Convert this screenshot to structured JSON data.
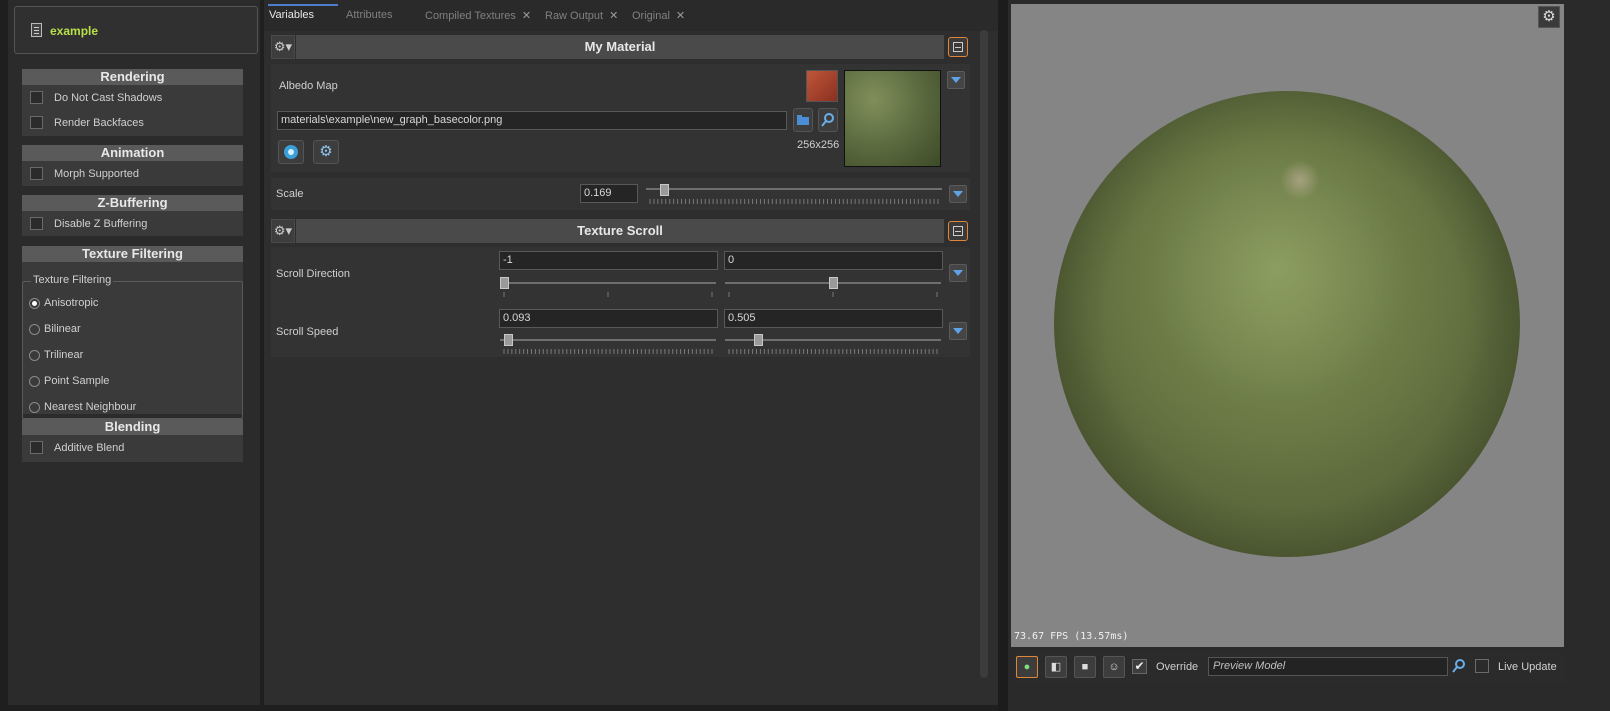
{
  "material_name": "example",
  "left": {
    "rendering": {
      "title": "Rendering",
      "items": [
        "Do Not Cast Shadows",
        "Render Backfaces"
      ]
    },
    "animation": {
      "title": "Animation",
      "items": [
        "Morph Supported"
      ]
    },
    "zbuffering": {
      "title": "Z-Buffering",
      "items": [
        "Disable Z Buffering"
      ]
    },
    "texture_filtering": {
      "title": "Texture Filtering",
      "legend": "Texture Filtering",
      "options": [
        "Anisotropic",
        "Bilinear",
        "Trilinear",
        "Point Sample",
        "Nearest Neighbour"
      ],
      "selected": "Anisotropic"
    },
    "blending": {
      "title": "Blending",
      "items": [
        "Additive Blend"
      ]
    }
  },
  "tabs": [
    {
      "label": "Variables",
      "active": true,
      "closable": false
    },
    {
      "label": "Attributes",
      "active": false,
      "closable": false
    },
    {
      "label": "Compiled Textures",
      "active": false,
      "closable": true
    },
    {
      "label": "Raw Output",
      "active": false,
      "closable": true
    },
    {
      "label": "Original",
      "active": false,
      "closable": true
    }
  ],
  "close_glyph": "✕",
  "my_material": {
    "title": "My Material",
    "albedo_label": "Albedo Map",
    "albedo_path": "materials\\example\\new_graph_basecolor.png",
    "texture_size": "256x256",
    "scale_label": "Scale",
    "scale_value": "0.169",
    "scale_fraction": 0.05
  },
  "texture_scroll": {
    "title": "Texture Scroll",
    "direction_label": "Scroll Direction",
    "direction_x": "-1",
    "direction_y": "0",
    "direction_x_fraction": 0.0,
    "direction_y_fraction": 0.5,
    "speed_label": "Scroll Speed",
    "speed_x": "0.093",
    "speed_y": "0.505",
    "speed_x_fraction": 0.02,
    "speed_y_fraction": 0.14
  },
  "viewport": {
    "fps_text": "73.67 FPS (13.57ms)",
    "override_label": "Override",
    "override_checked": true,
    "preview_placeholder": "Preview Model",
    "live_update_label": "Live Update"
  },
  "colors": {
    "accent_green": "#b7e04a",
    "accent_blue": "#4c7ec9",
    "accent_orange": "#e0863a"
  }
}
